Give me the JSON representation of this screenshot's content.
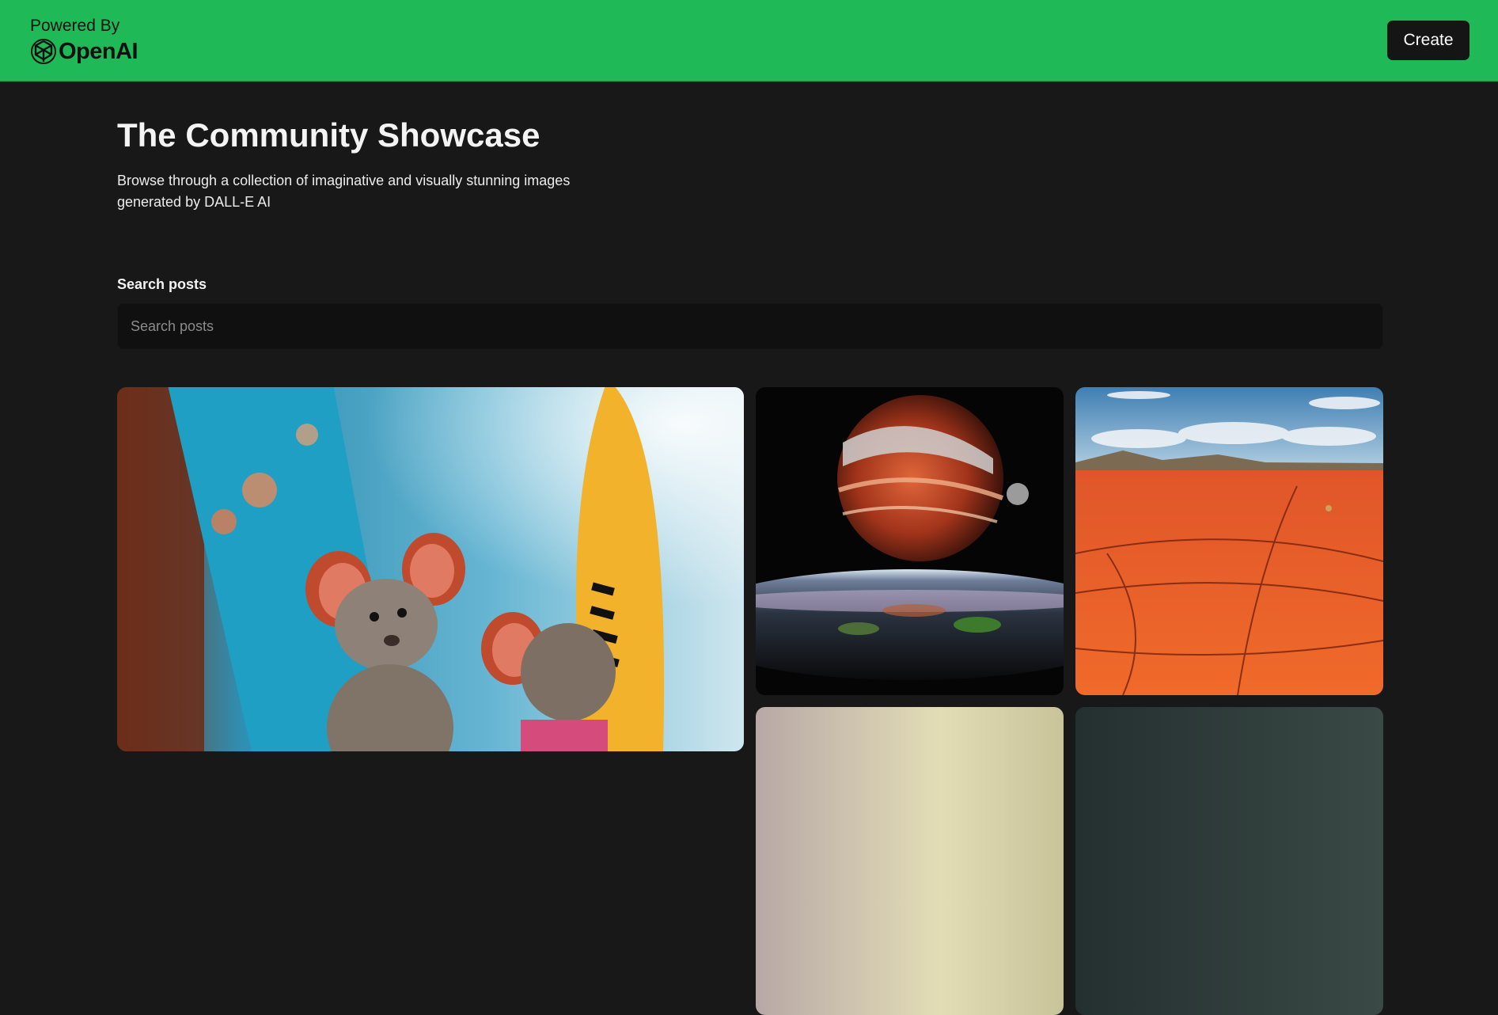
{
  "header": {
    "powered_by": "Powered By",
    "brand": "OpenAI",
    "create_label": "Create",
    "bg_color": "#1fb957"
  },
  "hero": {
    "title": "The Community Showcase",
    "subtitle": "Browse through a collection of imaginative and visually stunning images generated by DALL-E AI"
  },
  "search": {
    "label": "Search posts",
    "placeholder": "Search posts",
    "value": ""
  },
  "gallery": {
    "cards": [
      {
        "subject": "mice-with-surfboards-image"
      },
      {
        "subject": "planet-over-earth-image"
      },
      {
        "subject": "red-desert-landscape-image"
      },
      {
        "subject": "hazy-sky-image"
      },
      {
        "subject": "dark-scene-image"
      }
    ]
  }
}
